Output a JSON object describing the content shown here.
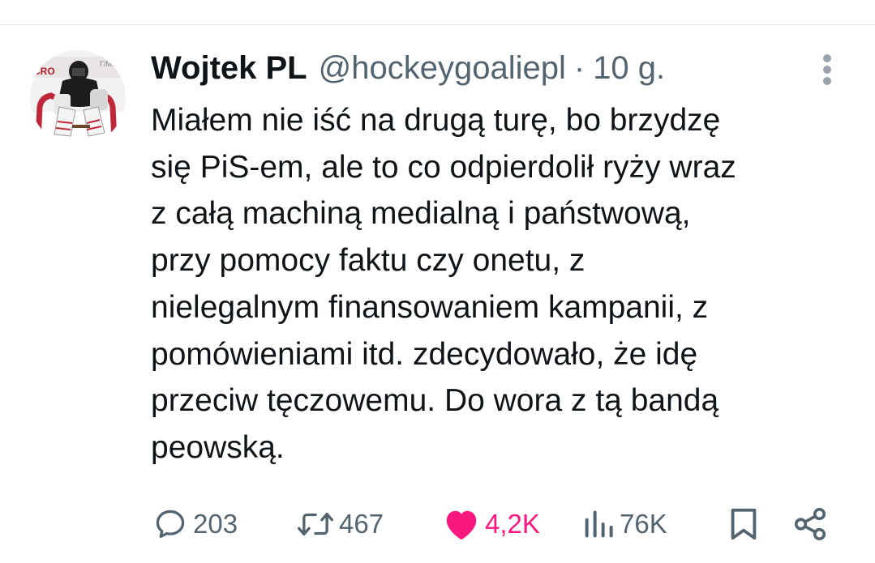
{
  "tweet": {
    "author_name": "Wojtek PL",
    "handle": "@hockeygoaliepl",
    "separator": "·",
    "timestamp": "10 g.",
    "text": "Miałem nie iść na drugą turę, bo brzydzę\nsię PiS-em, ale to co odpierdolił ryży wraz\nz całą machiną medialną i państwową,\nprzy pomocy faktu czy onetu, z\nnielegalnym finansowaniem kampanii, z\npomówieniami itd. zdecydowało, że idę\nprzeciw tęczowemu.  Do wora z tą bandą\npeowską."
  },
  "avatar": {
    "icon": "hockey-goalie-avatar"
  },
  "actions": {
    "replies": {
      "icon": "reply-icon",
      "count": "203"
    },
    "retweets": {
      "icon": "retweet-icon",
      "count": "467"
    },
    "likes": {
      "icon": "heart-icon",
      "count": "4,2K",
      "color": "#f91880"
    },
    "views": {
      "icon": "views-icon",
      "count": "76K"
    },
    "bookmark": {
      "icon": "bookmark-icon"
    },
    "share": {
      "icon": "share-icon"
    }
  },
  "colors": {
    "text_primary": "#0f1419",
    "text_secondary": "#536471",
    "like_pink": "#f91880",
    "divider": "#e6e9ec"
  }
}
